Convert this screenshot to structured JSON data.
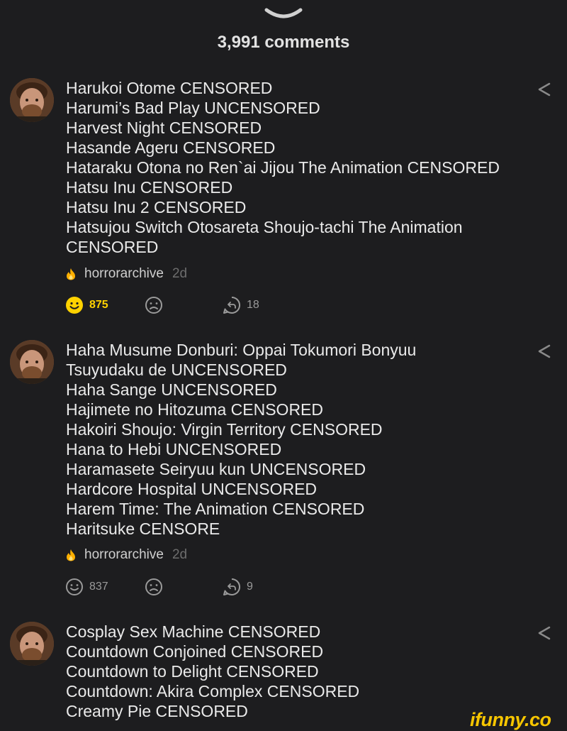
{
  "header": {
    "comments_count": "3,991 comments"
  },
  "comments": [
    {
      "lines": [
        "Harukoi Otome CENSORED",
        "Harumi’s Bad Play UNCENSORED",
        "Harvest Night CENSORED",
        "Hasande Ageru CENSORED",
        "Hataraku Otona no Ren`ai Jijou The Animation CENSORED",
        "Hatsu Inu CENSORED",
        "Hatsu Inu 2 CENSORED",
        "Hatsujou Switch Otosareta Shoujo-tachi The Animation",
        "CENSORED"
      ],
      "author": "horrorarchive",
      "time": "2d",
      "smiles": "875",
      "smiled": true,
      "replies": "18"
    },
    {
      "lines": [
        "Haha Musume Donburi: Oppai Tokumori Bonyuu",
        "Tsuyudaku de UNCENSORED",
        "Haha Sange UNCENSORED",
        "Hajimete no Hitozuma CENSORED",
        "Hakoiri Shoujo: Virgin Territory CENSORED",
        "Hana to Hebi UNCENSORED",
        "Haramasete Seiryuu kun UNCENSORED",
        "Hardcore Hospital UNCENSORED",
        "Harem Time: The Animation CENSORED",
        "Haritsuke CENSORE"
      ],
      "author": "horrorarchive",
      "time": "2d",
      "smiles": "837",
      "smiled": false,
      "replies": "9"
    },
    {
      "lines": [
        "Cosplay Sex Machine CENSORED",
        "Countdown Conjoined CENSORED",
        "Countdown to Delight CENSORED",
        "Countdown: Akira Complex CENSORED",
        "Creamy Pie CENSORED"
      ]
    }
  ],
  "watermark": "ifunny.co",
  "colors": {
    "background": "#1d1d1f",
    "text": "#eaeaea",
    "muted": "#6d6d6d",
    "accent_yellow": "#ffd200",
    "fire_orange": "#ffb000"
  },
  "icons": [
    "chevron-down-icon",
    "share-icon",
    "fire-icon",
    "smile-icon",
    "frown-icon",
    "reply-icon"
  ]
}
